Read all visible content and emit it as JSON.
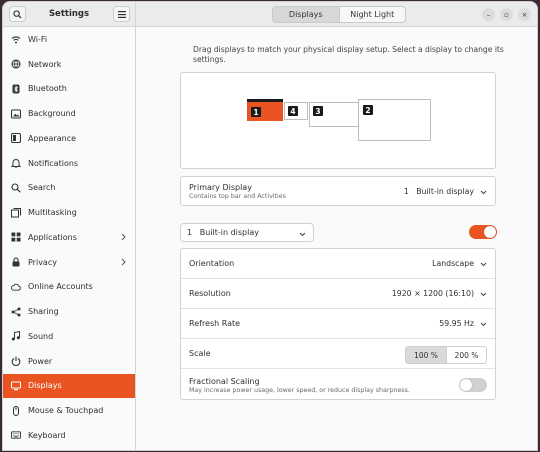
{
  "header": {
    "app_title": "Settings",
    "tabs": [
      {
        "label": "Displays",
        "active": true
      },
      {
        "label": "Night Light",
        "active": false
      }
    ],
    "window_controls": [
      "–",
      "▫",
      "×"
    ]
  },
  "sidebar": {
    "items": [
      {
        "label": "Wi-Fi",
        "icon": "wifi-icon"
      },
      {
        "label": "Network",
        "icon": "network-icon"
      },
      {
        "label": "Bluetooth",
        "icon": "bluetooth-icon"
      },
      {
        "label": "Background",
        "icon": "background-icon"
      },
      {
        "label": "Appearance",
        "icon": "appearance-icon"
      },
      {
        "label": "Notifications",
        "icon": "bell-icon"
      },
      {
        "label": "Search",
        "icon": "search-icon"
      },
      {
        "label": "Multitasking",
        "icon": "multitasking-icon"
      },
      {
        "label": "Applications",
        "icon": "applications-icon",
        "chevron": true
      },
      {
        "label": "Privacy",
        "icon": "privacy-icon",
        "chevron": true
      },
      {
        "label": "Online Accounts",
        "icon": "cloud-icon"
      },
      {
        "label": "Sharing",
        "icon": "sharing-icon"
      },
      {
        "label": "Sound",
        "icon": "music-icon"
      },
      {
        "label": "Power",
        "icon": "power-icon"
      },
      {
        "label": "Displays",
        "icon": "display-icon",
        "selected": true
      },
      {
        "label": "Mouse & Touchpad",
        "icon": "mouse-icon"
      },
      {
        "label": "Keyboard",
        "icon": "keyboard-icon"
      }
    ]
  },
  "main": {
    "hint": "Drag displays to match your physical display setup. Select a display to change its settings.",
    "monitors": [
      {
        "number": "1",
        "primary": true
      },
      {
        "number": "4"
      },
      {
        "number": "3"
      },
      {
        "number": "2"
      }
    ],
    "primary_display": {
      "label": "Primary Display",
      "subtitle": "Contains top bar and Activities",
      "value": "1   Built-in display"
    },
    "display_selector": "1   Built-in display",
    "display_enabled": true,
    "settings": {
      "orientation": {
        "label": "Orientation",
        "value": "Landscape"
      },
      "resolution": {
        "label": "Resolution",
        "value": "1920 × 1200 (16:10)"
      },
      "refresh_rate": {
        "label": "Refresh Rate",
        "value": "59.95 Hz"
      },
      "scale": {
        "label": "Scale",
        "options": [
          "100 %",
          "200 %"
        ],
        "selected": "100 %"
      },
      "fractional_scaling": {
        "label": "Fractional Scaling",
        "subtitle": "May increase power usage, lower speed, or reduce display sharpness.",
        "enabled": false
      }
    }
  },
  "colors": {
    "accent": "#e95420",
    "toggle_off": "#d0d0d0"
  }
}
